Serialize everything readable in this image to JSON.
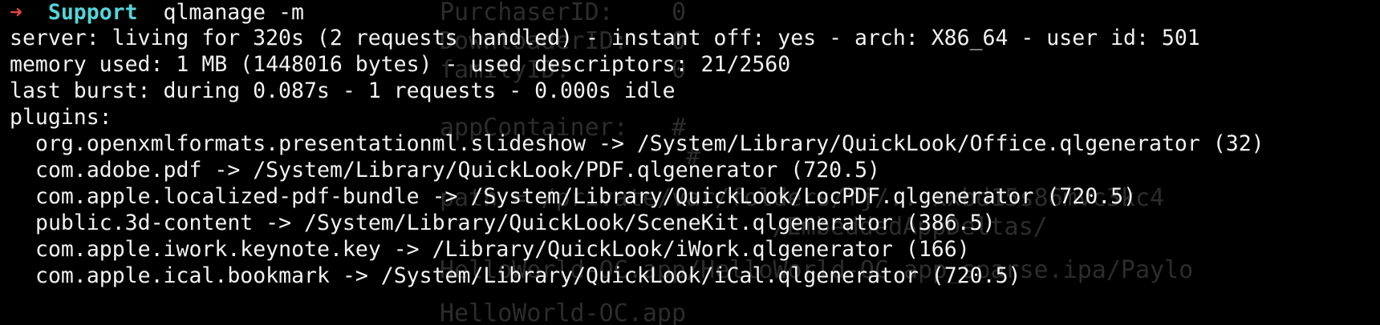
{
  "prompt": {
    "arrow": "➜",
    "directory": "Support",
    "command": "qlmanage -m"
  },
  "output": {
    "server": "server: living for 320s (2 requests handled) - instant off: yes - arch: X86_64 - user id: 501",
    "memory": "memory used: 1 MB (1448016 bytes) - used descriptors: 21/2560",
    "burst": "last burst: during 0.087s - 1 requests - 0.000s idle",
    "plugins_header": "plugins:",
    "plugins": [
      "org.openxmlformats.presentationml.slideshow -> /System/Library/QuickLook/Office.qlgenerator (32)",
      "com.adobe.pdf -> /System/Library/QuickLook/PDF.qlgenerator (720.5)",
      "com.apple.localized-pdf-bundle -> /System/Library/QuickLook/LocPDF.qlgenerator (720.5)",
      "public.3d-content -> /System/Library/QuickLook/SceneKit.qlgenerator (386.5)",
      "com.apple.iwork.keynote.key -> /Library/QuickLook/iWork.qlgenerator (166)",
      "com.apple.ical.bookmark -> /System/Library/QuickLook/iCal.qlgenerator (720.5)"
    ]
  },
  "background_window": {
    "lines": [
      "PurchaserID:    0",
      "DownloaderID:   0",
      "familyID:       0",
      "appContainer:   #",
      "                 #",
      "path = /private/var/folders/fj/...xxbd15s86mvc3kc4",
      "         /EmbeddedAppDeltas/",
      "HelloWorld-OC.app/HelloWorld-OC.app_sparse.ipa/Paylo",
      "HelloWorld-OC.app"
    ]
  },
  "colors": {
    "background": "#000000",
    "text": "#f2f2f2",
    "prompt_arrow": "#e0453d",
    "prompt_directory": "#56d4d8",
    "ghost_text": "#2c2c2c"
  }
}
